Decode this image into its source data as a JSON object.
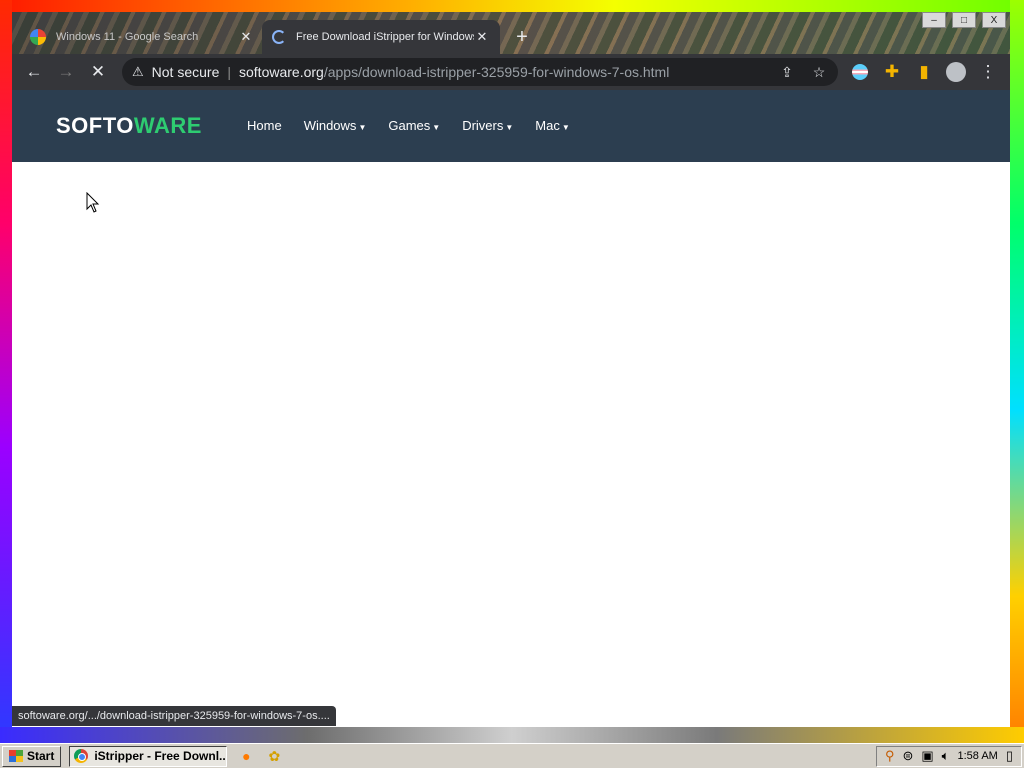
{
  "browser": {
    "tabs": [
      {
        "title": "Windows 11 - Google Search",
        "active": false,
        "favicon": "google-icon"
      },
      {
        "title": "Free Download iStripper for Windows",
        "active": true,
        "favicon": "loading-spinner-icon"
      }
    ],
    "new_tab_label": "+",
    "window_controls": {
      "minimize": "–",
      "maximize": "□",
      "close": "X"
    },
    "address": {
      "security_text": "Not secure",
      "host": "softoware.org",
      "path": "/apps/download-istripper-325959-for-windows-7-os.html"
    },
    "status_url": "softoware.org/.../download-istripper-325959-for-windows-7-os...."
  },
  "site": {
    "logo_part1": "SOFTO",
    "logo_part2": "WARE",
    "nav": [
      {
        "label": "Home",
        "dropdown": false
      },
      {
        "label": "Windows",
        "dropdown": true
      },
      {
        "label": "Games",
        "dropdown": true
      },
      {
        "label": "Drivers",
        "dropdown": true
      },
      {
        "label": "Mac",
        "dropdown": true
      }
    ],
    "colors": {
      "header_bg": "#2c3e50",
      "logo_accent": "#2ecc71"
    }
  },
  "taskbar": {
    "start_label": "Start",
    "task_item": "iStripper - Free Downl...",
    "clock": "1:58 AM"
  }
}
